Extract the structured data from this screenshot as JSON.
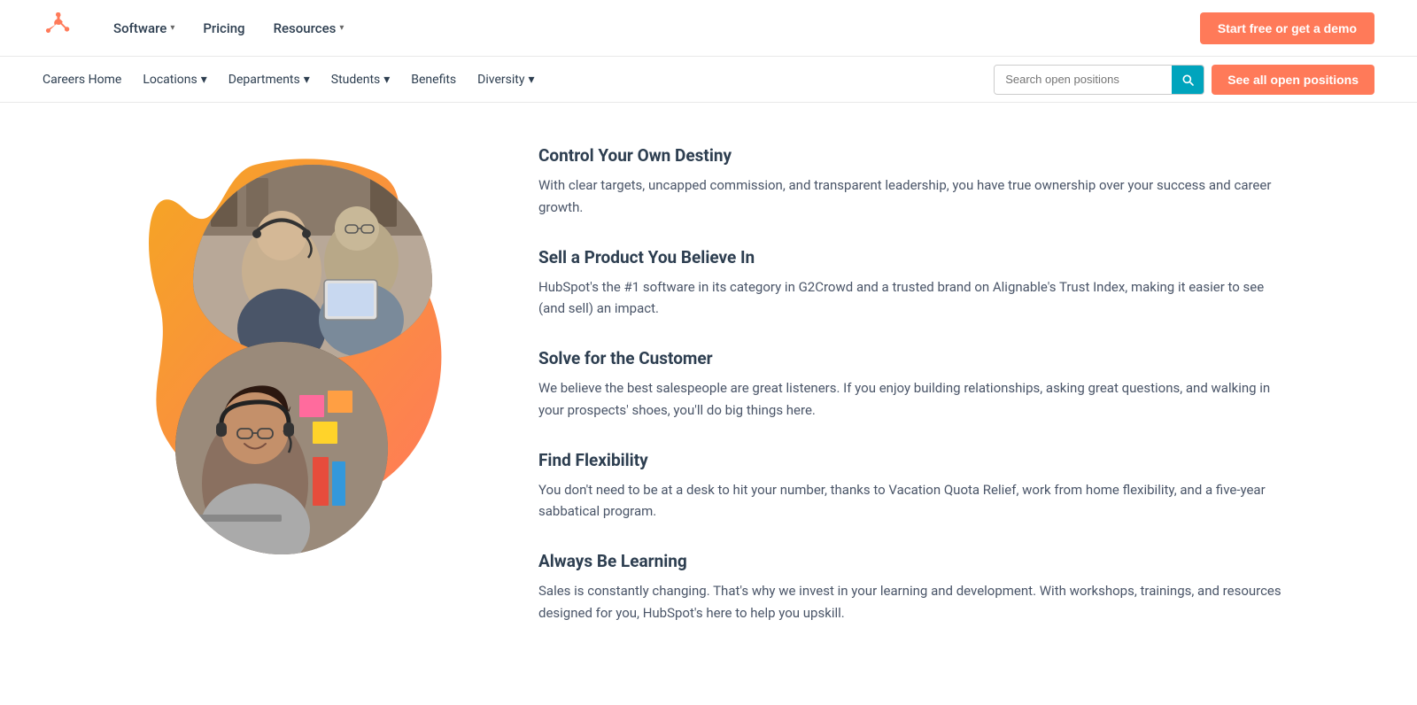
{
  "topNav": {
    "logo_alt": "HubSpot logo",
    "links": [
      {
        "label": "Software",
        "has_dropdown": true
      },
      {
        "label": "Pricing",
        "has_dropdown": false
      },
      {
        "label": "Resources",
        "has_dropdown": true
      }
    ],
    "cta_label": "Start free or get a demo"
  },
  "careersNav": {
    "links": [
      {
        "label": "Careers Home",
        "has_dropdown": false
      },
      {
        "label": "Locations",
        "has_dropdown": true
      },
      {
        "label": "Departments",
        "has_dropdown": true
      },
      {
        "label": "Students",
        "has_dropdown": true
      },
      {
        "label": "Benefits",
        "has_dropdown": false
      },
      {
        "label": "Diversity",
        "has_dropdown": true
      }
    ],
    "search_placeholder": "Search open positions",
    "see_all_label": "See all open positions"
  },
  "features": [
    {
      "title": "Control Your Own Destiny",
      "description": "With clear targets, uncapped commission, and transparent leadership, you have true ownership over your success and career growth."
    },
    {
      "title": "Sell a Product You Believe In",
      "description": "HubSpot's the #1 software in its category in G2Crowd and a trusted brand on Alignable's Trust Index, making it easier to see (and sell) an impact."
    },
    {
      "title": "Solve for the Customer",
      "description": "We believe the best salespeople are great listeners. If you enjoy building relationships, asking great questions, and walking in your prospects' shoes, you'll do big things here."
    },
    {
      "title": "Find Flexibility",
      "description": "You don't need to be at a desk to hit your number, thanks to Vacation Quota Relief, work from home flexibility, and a five-year sabbatical program."
    },
    {
      "title": "Always Be Learning",
      "description": "Sales is constantly changing. That's why we invest in your learning and development. With workshops, trainings, and resources designed for you, HubSpot's here to help you upskill."
    }
  ]
}
